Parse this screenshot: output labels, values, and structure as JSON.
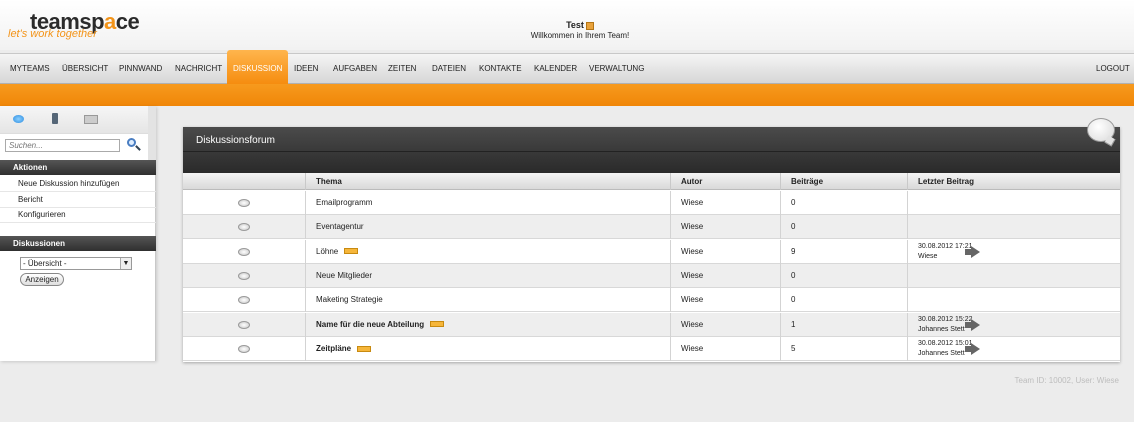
{
  "brand": {
    "name_part1": "teamsp",
    "name_part2": "a",
    "name_part3": "ce",
    "tagline": "let's work together"
  },
  "header": {
    "user_name": "Test",
    "welcome": "Willkommen in Ihrem Team!"
  },
  "nav": {
    "items": [
      "MYTEAMS",
      "ÜBERSICHT",
      "PINNWAND",
      "NACHRICHT",
      "DISKUSSION",
      "IDEEN",
      "AUFGABEN",
      "ZEITEN",
      "DATEIEN",
      "KONTAKTE",
      "KALENDER",
      "VERWALTUNG"
    ],
    "active": "DISKUSSION",
    "logout": "LOGOUT"
  },
  "sidebar": {
    "search_placeholder": "Suchen...",
    "actions_title": "Aktionen",
    "actions": [
      "Neue Diskussion hinzufügen",
      "Bericht",
      "Konfigurieren"
    ],
    "discussions_title": "Diskussionen",
    "select_value": "- Übersicht -",
    "show_button": "Anzeigen"
  },
  "forum": {
    "title": "Diskussionsforum",
    "columns": [
      "Thema",
      "Autor",
      "Beiträge",
      "Letzter Beitrag"
    ],
    "rows": [
      {
        "topic": "Emailprogramm",
        "author": "Wiese",
        "posts": "0",
        "last_date": "",
        "last_user": "",
        "new": false,
        "bold": false
      },
      {
        "topic": "Eventagentur",
        "author": "Wiese",
        "posts": "0",
        "last_date": "",
        "last_user": "",
        "new": false,
        "bold": false
      },
      {
        "topic": "Löhne",
        "author": "Wiese",
        "posts": "9",
        "last_date": "30.08.2012 17:21",
        "last_user": "Wiese",
        "new": true,
        "bold": false
      },
      {
        "topic": "Neue Mitglieder",
        "author": "Wiese",
        "posts": "0",
        "last_date": "",
        "last_user": "",
        "new": false,
        "bold": false
      },
      {
        "topic": "Maketing Strategie",
        "author": "Wiese",
        "posts": "0",
        "last_date": "",
        "last_user": "",
        "new": false,
        "bold": false
      },
      {
        "topic": "Name für die neue Abteilung",
        "author": "Wiese",
        "posts": "1",
        "last_date": "30.08.2012 15:22",
        "last_user": "Johannes Stett",
        "new": true,
        "bold": true
      },
      {
        "topic": "Zeitpläne",
        "author": "Wiese",
        "posts": "5",
        "last_date": "30.08.2012 15:01",
        "last_user": "Johannes Stett",
        "new": true,
        "bold": true
      }
    ]
  },
  "footer": {
    "info": "Team ID: 10002, User: Wiese"
  },
  "colors": {
    "accent": "#f39419",
    "nav_active": "#f58b0d",
    "panel_dark": "#2f2f2f"
  }
}
